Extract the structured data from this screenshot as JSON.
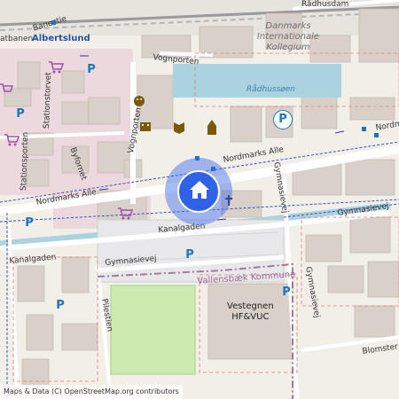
{
  "map": {
    "labels": {
      "station": "Albertslund",
      "street_baneste": "Banestie",
      "street_radhusdam": "Rådhusdam",
      "street_vognporten1": "Vognporten",
      "street_vognporten2": "Vognporten",
      "street_stationstorvet": "Stationstorvet",
      "street_stationsporten": "Stationsporten",
      "street_byfornet": "Byfornet",
      "street_nordmarks_w": "Nordmarks Alle",
      "street_nordmarks_e": "Nordmarks Alle",
      "street_nordma_edge": "Nordma",
      "street_kanalgaden_w": "Kanalgaden",
      "street_kanalgaden_e": "Kanalgaden",
      "street_gymnasievej_s": "Gymnasievej",
      "street_gymnasievej_n": "Gymnasievej",
      "street_gymnasievej_e": "Gymnasievej",
      "street_gymnasievej_v": "Gymnasievej",
      "street_pilestien": "Pilestien",
      "street_blomster": "Blomster",
      "street_atbanen": "atbanen",
      "kollegium": "Danmarks Internationale Kollegium",
      "kollegium_line1": "Danmarks",
      "kollegium_line2": "Internationale",
      "kollegium_line3": "Kollegium",
      "water": "Rådhussøen",
      "municipality": "Vallensbæk Kommune",
      "school_line1": "Vestegnen",
      "school_line2": "HF&VUC"
    },
    "parking_symbol": "P",
    "attribution": "Maps & Data (C) OpenStreetMap.org contributors",
    "marker_icon": "home-icon",
    "icons": [
      "shopping-cart-icon",
      "theatre-icon",
      "cinema-icon",
      "library-icon",
      "monument-icon",
      "church-icon",
      "parking-icon",
      "bus-stop-icon"
    ],
    "colors": {
      "background": "#f2efe9",
      "building": "#d9d0c9",
      "water": "#aad3df",
      "park": "#cdebb0",
      "marker": "#2f62e8",
      "parking": "#1d74b8",
      "boundary": "#a07aa0",
      "road": "#ffffff"
    }
  }
}
